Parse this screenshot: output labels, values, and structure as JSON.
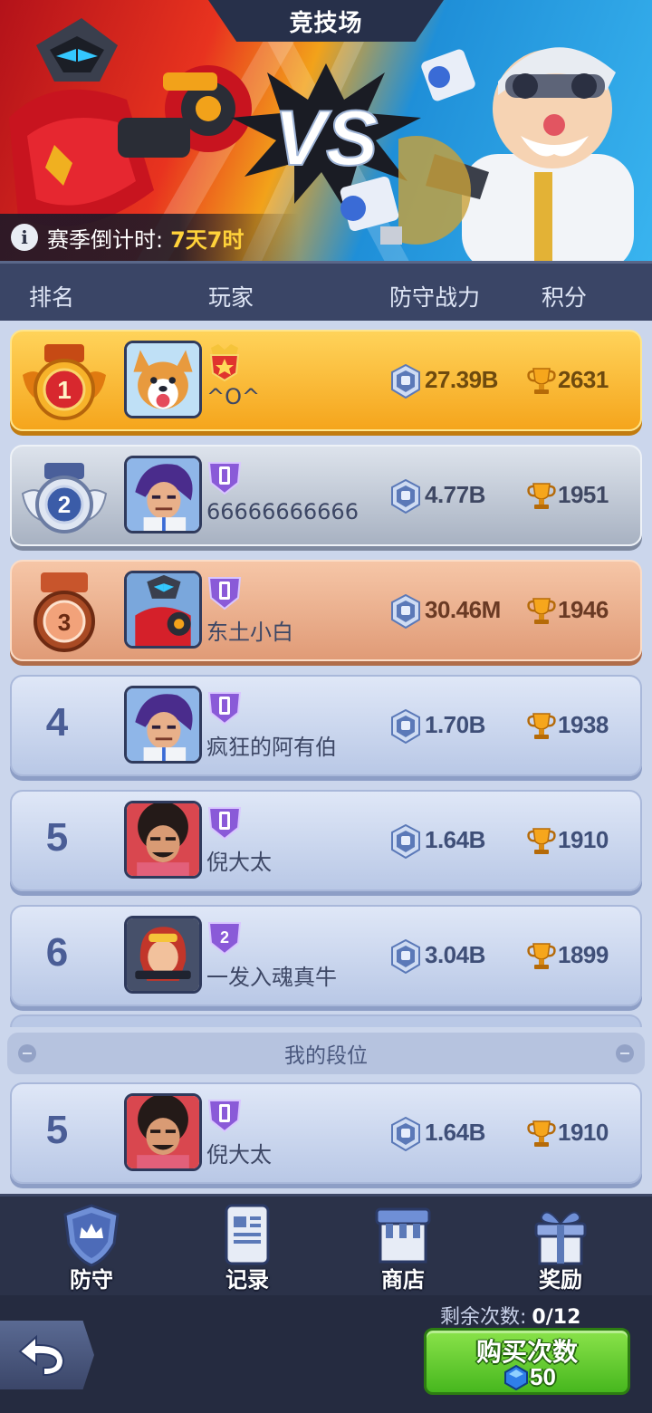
{
  "title": "竞技场",
  "countdown": {
    "label": "赛季倒计时:",
    "value": "7天7时"
  },
  "columns": {
    "rank": "排名",
    "player": "玩家",
    "power": "防守战力",
    "score": "积分"
  },
  "rankings": [
    {
      "rank": "1",
      "name": "^O^",
      "power": "27.39B",
      "score": "2631",
      "tier": "gold",
      "badge_num": ""
    },
    {
      "rank": "2",
      "name": "66666666666",
      "power": "4.77B",
      "score": "1951",
      "tier": "silver",
      "badge_num": ""
    },
    {
      "rank": "3",
      "name": "东土小白",
      "power": "30.46M",
      "score": "1946",
      "tier": "bronze",
      "badge_num": ""
    },
    {
      "rank": "4",
      "name": "疯狂的阿有伯",
      "power": "1.70B",
      "score": "1938",
      "tier": "normal",
      "badge_num": ""
    },
    {
      "rank": "5",
      "name": "倪大太",
      "power": "1.64B",
      "score": "1910",
      "tier": "normal",
      "badge_num": ""
    },
    {
      "rank": "6",
      "name": "一发入魂真牛",
      "power": "3.04B",
      "score": "1899",
      "tier": "normal",
      "badge_num": "2"
    }
  ],
  "my_rank": {
    "section_label": "我的段位",
    "rank": "5",
    "name": "倪大太",
    "power": "1.64B",
    "score": "1910"
  },
  "nav": [
    {
      "label": "防守",
      "icon": "shield-crown-icon"
    },
    {
      "label": "记录",
      "icon": "scroll-record-icon"
    },
    {
      "label": "商店",
      "icon": "shop-icon"
    },
    {
      "label": "奖励",
      "icon": "gift-icon"
    }
  ],
  "footer": {
    "remaining_label": "剩余次数:",
    "remaining_value": "0/12",
    "buy_label": "购买次数",
    "buy_cost": "50"
  },
  "colors": {
    "gold_row": "#f5a51c",
    "silver_row": "#a8b2c2",
    "bronze_row": "#e09b77",
    "normal_row": "#b9c8e6",
    "buy_button": "#47b71e",
    "countdown_value": "#ffd23a"
  }
}
